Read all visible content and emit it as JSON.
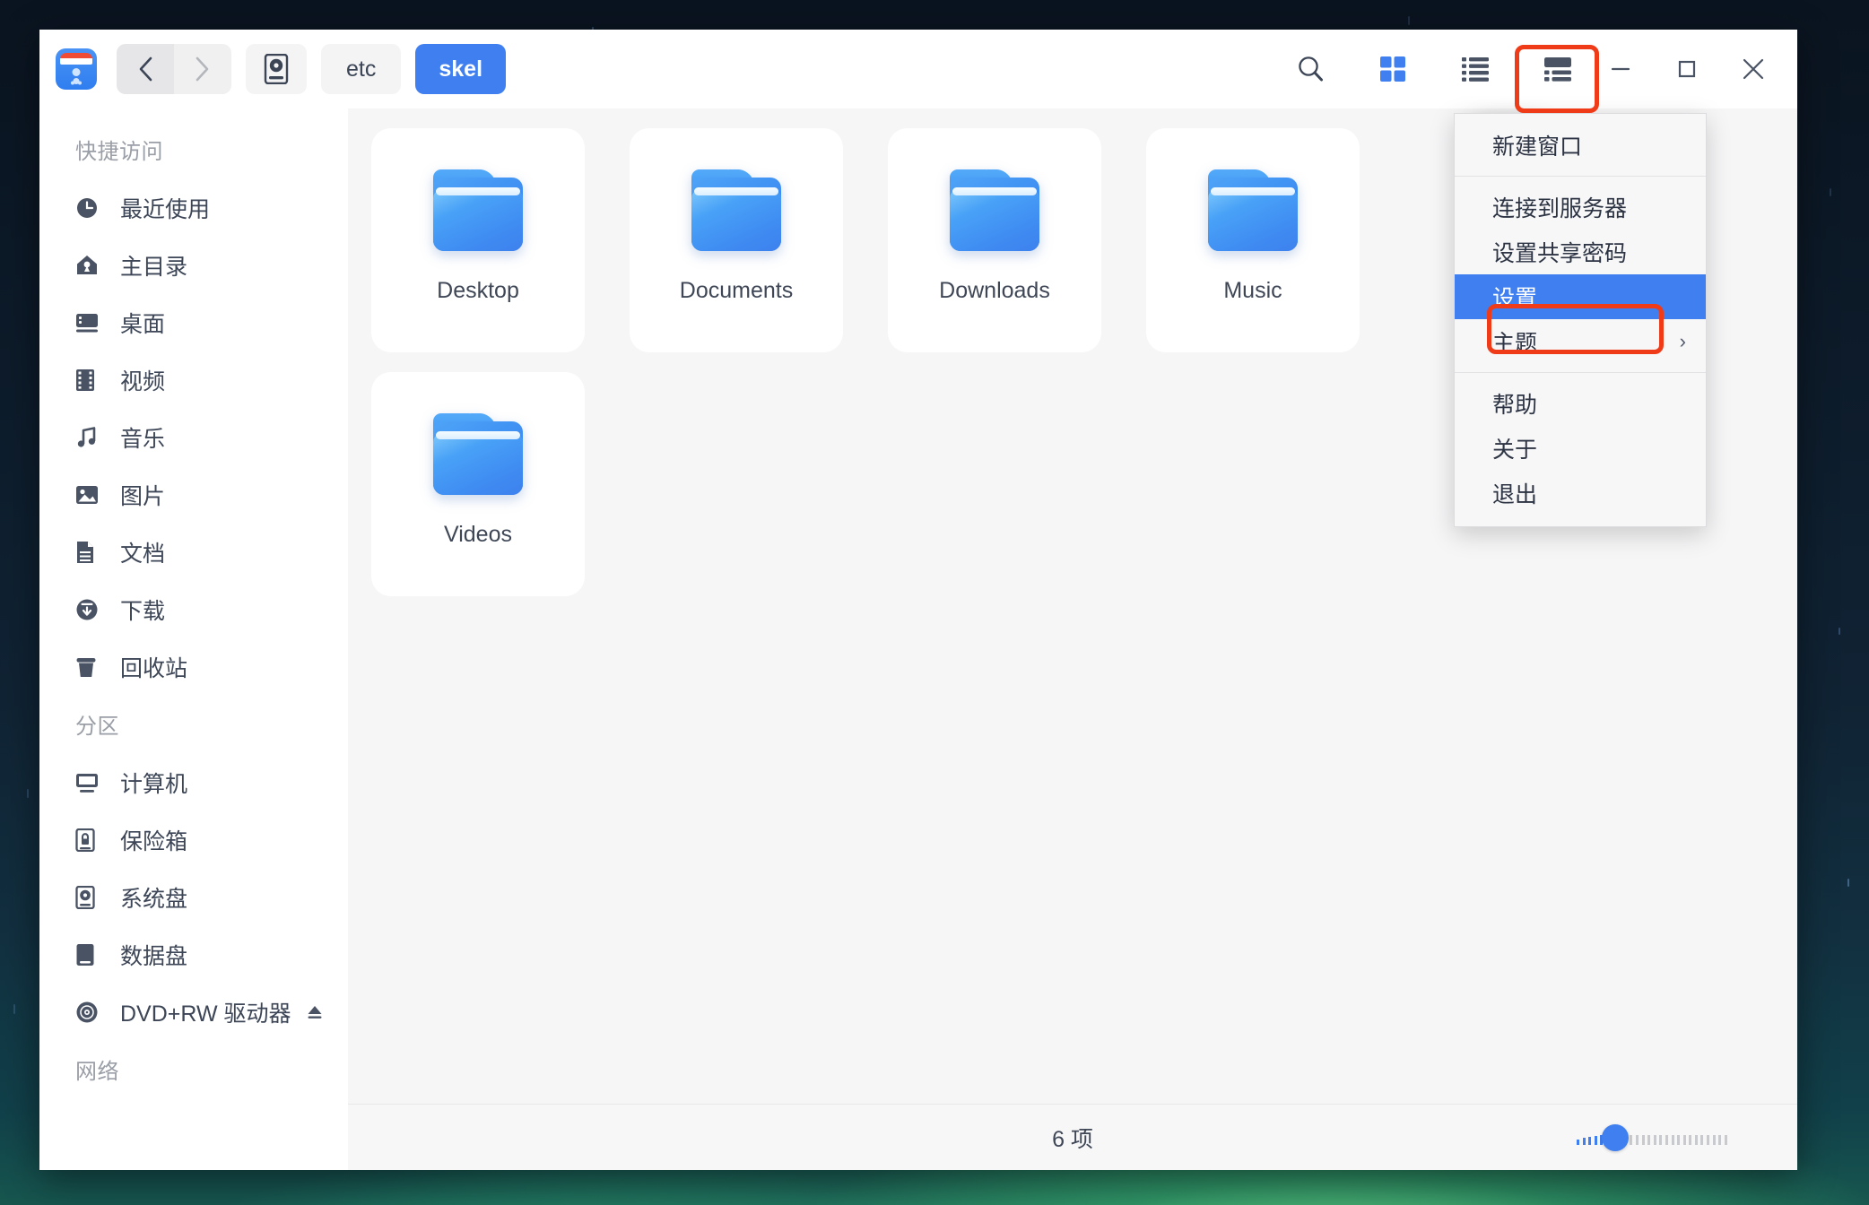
{
  "window": {
    "app_icon_name": "file-manager-app-icon",
    "controls": {
      "minimize": "—",
      "maximize": "□",
      "close": "✕"
    }
  },
  "toolbar": {
    "back_label": "‹",
    "forward_label": "›",
    "breadcrumbs": [
      {
        "label": "",
        "icon": "hard-disk-icon",
        "active": false
      },
      {
        "label": "etc",
        "icon": "",
        "active": false
      },
      {
        "label": "skel",
        "icon": "",
        "active": true
      }
    ],
    "search_label": "search-icon",
    "view_icon_label": "icon-view",
    "view_list_label": "list-view",
    "view_detail_label": "detail-view",
    "menu_label": "more-menu",
    "active_view": "icon-view",
    "accent_color": "#3f7ff0",
    "highlight_color": "#ef3b18"
  },
  "sidebar": {
    "sections": [
      {
        "title": "快捷访问",
        "items": [
          {
            "label": "最近使用",
            "icon": "clock-icon"
          },
          {
            "label": "主目录",
            "icon": "home-icon"
          },
          {
            "label": "桌面",
            "icon": "desktop-icon"
          },
          {
            "label": "视频",
            "icon": "film-icon"
          },
          {
            "label": "音乐",
            "icon": "music-note-icon"
          },
          {
            "label": "图片",
            "icon": "image-icon"
          },
          {
            "label": "文档",
            "icon": "document-icon"
          },
          {
            "label": "下载",
            "icon": "download-icon"
          },
          {
            "label": "回收站",
            "icon": "trash-icon"
          }
        ]
      },
      {
        "title": "分区",
        "items": [
          {
            "label": "计算机",
            "icon": "computer-icon"
          },
          {
            "label": "保险箱",
            "icon": "safe-box-icon"
          },
          {
            "label": "系统盘",
            "icon": "system-disk-icon"
          },
          {
            "label": "数据盘",
            "icon": "data-disk-icon"
          },
          {
            "label": "DVD+RW 驱动器",
            "icon": "optical-disc-icon",
            "eject": "⏏"
          }
        ]
      },
      {
        "title": "网络",
        "items": []
      }
    ]
  },
  "main": {
    "files": [
      {
        "name": "Desktop",
        "icon": "folder-icon"
      },
      {
        "name": "Documents",
        "icon": "folder-icon"
      },
      {
        "name": "Downloads",
        "icon": "folder-icon"
      },
      {
        "name": "Music",
        "icon": "folder-icon"
      },
      {
        "name": "Videos",
        "icon": "folder-icon"
      }
    ]
  },
  "statusbar": {
    "item_count": "6 项",
    "zoom_level": 30
  },
  "menu": {
    "groups": [
      {
        "items": [
          {
            "label": "新建窗口",
            "selected": false,
            "submenu": false
          }
        ]
      },
      {
        "items": [
          {
            "label": "连接到服务器",
            "selected": false,
            "submenu": false
          },
          {
            "label": "设置共享密码",
            "selected": false,
            "submenu": false
          },
          {
            "label": "设置",
            "selected": true,
            "submenu": false
          },
          {
            "label": "主题",
            "selected": false,
            "submenu": true,
            "arrow": "›"
          }
        ]
      },
      {
        "items": [
          {
            "label": "帮助",
            "selected": false,
            "submenu": false
          },
          {
            "label": "关于",
            "selected": false,
            "submenu": false
          },
          {
            "label": "退出",
            "selected": false,
            "submenu": false
          }
        ]
      }
    ]
  }
}
